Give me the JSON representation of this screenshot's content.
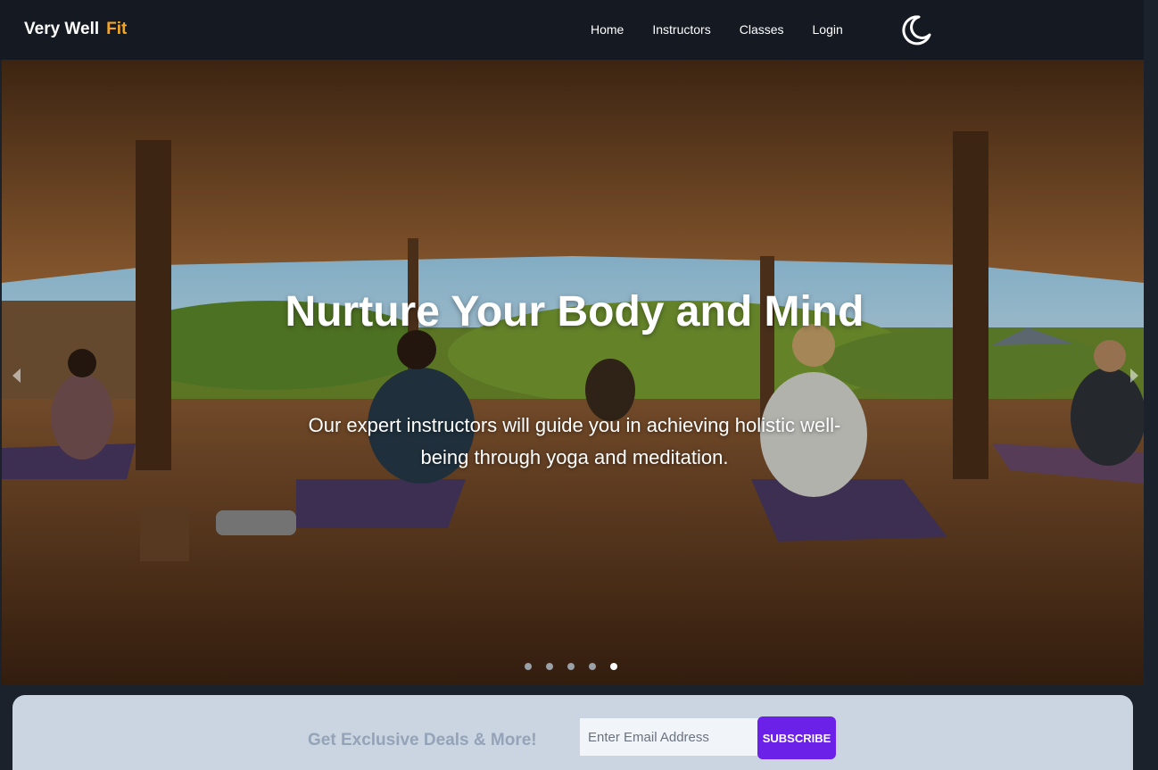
{
  "navbar": {
    "brand": "Very Well",
    "brand_accent": "Fit",
    "links": [
      "Home",
      "Instructors",
      "Classes",
      "Login"
    ],
    "theme_icon": "moon-icon"
  },
  "hero": {
    "title": "Nurture Your Body and Mind",
    "subtitle": "Our expert instructors will guide you in achieving holistic well-being through yoga and meditation.",
    "slide_count": 5,
    "active_slide": 5,
    "prev_icon": "chevron-left-icon",
    "next_icon": "chevron-right-icon"
  },
  "deals": {
    "label": "Get Exclusive Deals & More!",
    "email_placeholder": "Enter Email Address",
    "subscribe_label": "SUBSCRIBE"
  },
  "colors": {
    "nav_bg": "#151a22",
    "brand_accent": "#f5a524",
    "deals_bg": "#cbd5e1",
    "subscribe_bg": "#6b21e8"
  }
}
